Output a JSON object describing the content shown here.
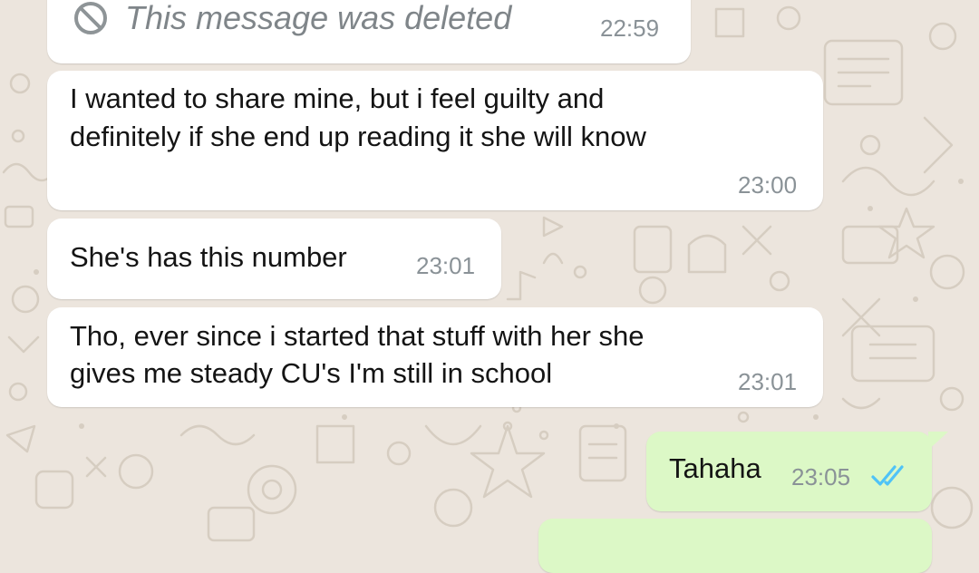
{
  "chat": {
    "theme": {
      "background": "#ece5dd",
      "incoming_bubble": "#ffffff",
      "outgoing_bubble": "#dcf8c6",
      "tick_read": "#4fc3f7"
    },
    "messages": [
      {
        "direction": "incoming",
        "deleted": true,
        "icon": "blocked-icon",
        "text": "This message was deleted",
        "time": "22:59"
      },
      {
        "direction": "incoming",
        "lines": [
          "I wanted to share mine, but i feel guilty and",
          "definitely if she end up reading it she will know"
        ],
        "time": "23:00"
      },
      {
        "direction": "incoming",
        "lines": [
          "She's has this number"
        ],
        "time": "23:01"
      },
      {
        "direction": "incoming",
        "lines": [
          "Tho, ever since i started that stuff with her she",
          "gives me steady CU's I'm still in school"
        ],
        "time": "23:01"
      },
      {
        "direction": "outgoing",
        "lines": [
          "Tahaha"
        ],
        "time": "23:05",
        "status": "read",
        "status_icon": "double-check-icon"
      },
      {
        "direction": "outgoing",
        "lines": [],
        "time": "",
        "partial": true
      }
    ]
  }
}
